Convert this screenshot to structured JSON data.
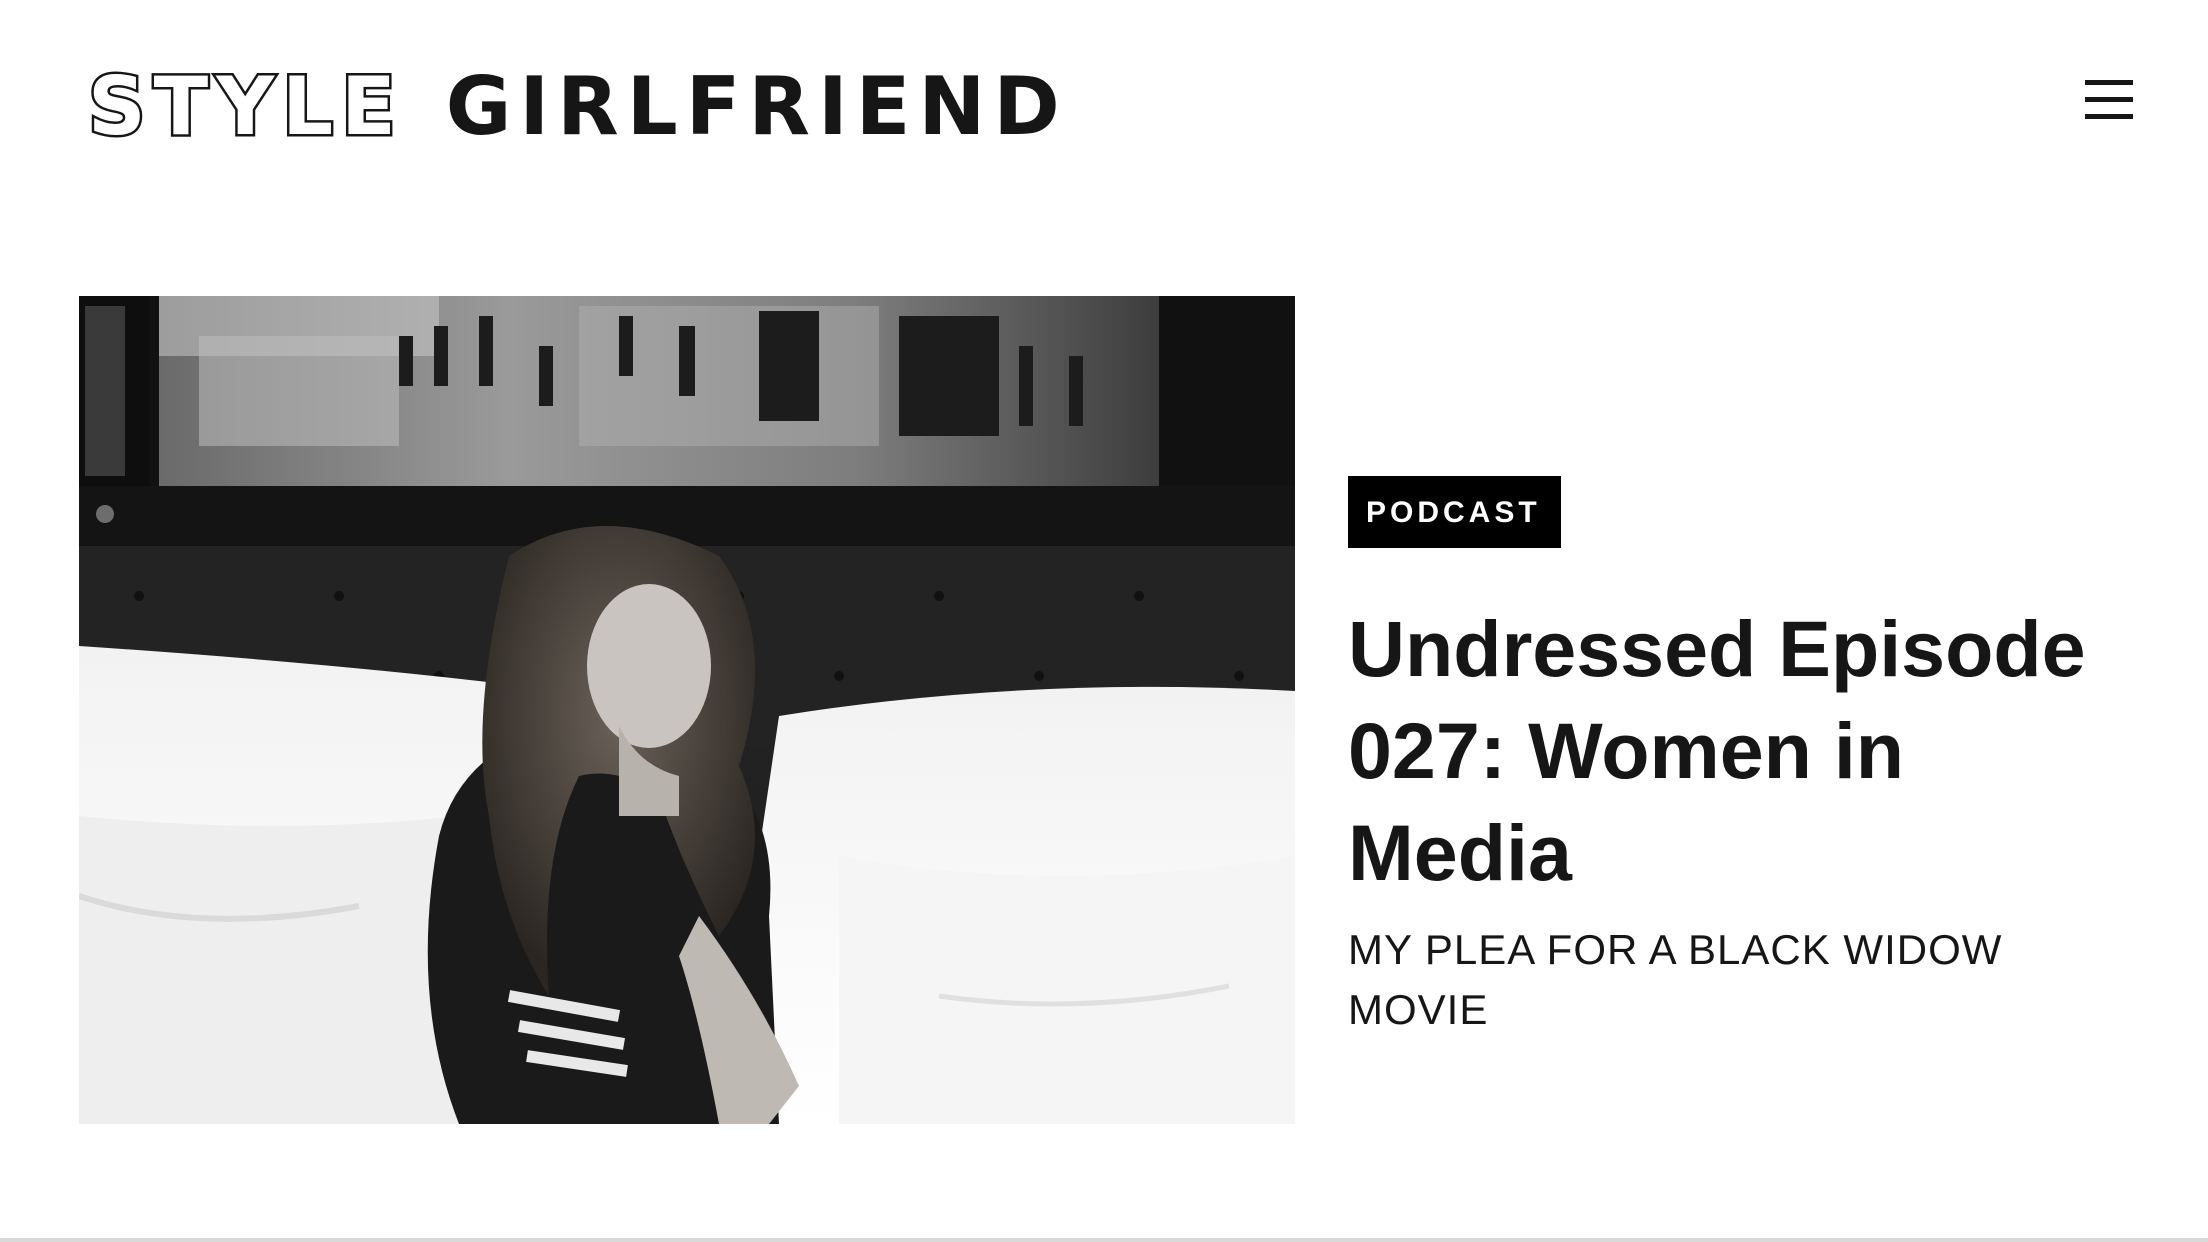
{
  "header": {
    "logo_part1": "STYLE",
    "logo_part2": "GIRLFRIEND",
    "menu_icon": "hamburger-menu-icon"
  },
  "article": {
    "category": "PODCAST",
    "title": "Undressed Episode 027: Women in Media",
    "subtitle": "MY PLEA FOR A BLACK WIDOW MOVIE",
    "image_alt": ""
  },
  "colors": {
    "text": "#161616",
    "tag_background": "#000000",
    "tag_text": "#ffffff",
    "page_background": "#ffffff"
  }
}
